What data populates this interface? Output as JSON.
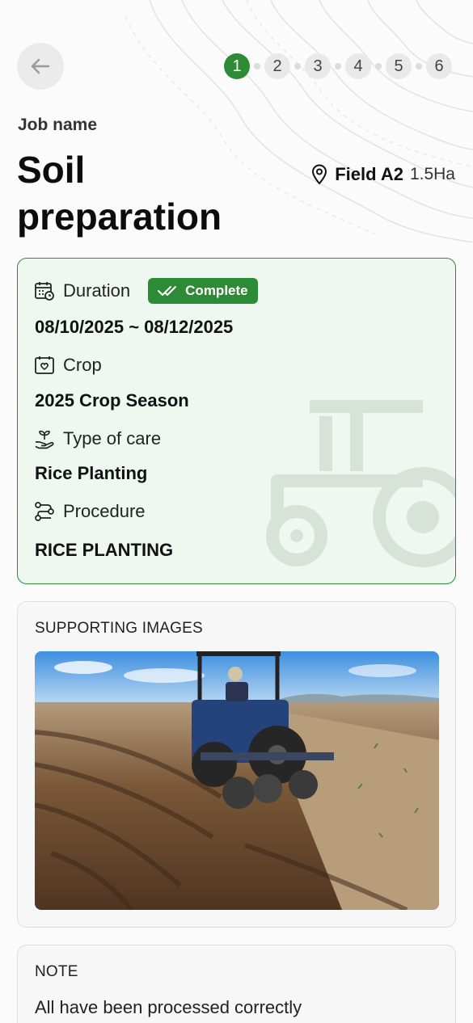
{
  "colors": {
    "accent": "#2e8b35",
    "card_bg": "#eef8f0"
  },
  "header": {
    "back_icon": "arrow-left-icon",
    "steps": [
      "1",
      "2",
      "3",
      "4",
      "5",
      "6"
    ],
    "active_step": 1
  },
  "job": {
    "label": "Job name",
    "title": "Soil preparation",
    "field_icon": "location-pin-icon",
    "field_name": "Field A2",
    "field_size": "1.5Ha"
  },
  "details": {
    "duration_label": "Duration",
    "status_badge": "Complete",
    "duration_value": "08/10/2025 ~ 08/12/2025",
    "crop_label": "Crop",
    "crop_value": "2025 Crop Season",
    "care_label": "Type of care",
    "care_value": "Rice Planting",
    "procedure_label": "Procedure",
    "procedure_value": "RICE PLANTING"
  },
  "images": {
    "title": "SUPPORTING IMAGES",
    "photo_subject": "tractor plowing field"
  },
  "note": {
    "title": "NOTE",
    "text": "All have been processed correctly"
  }
}
